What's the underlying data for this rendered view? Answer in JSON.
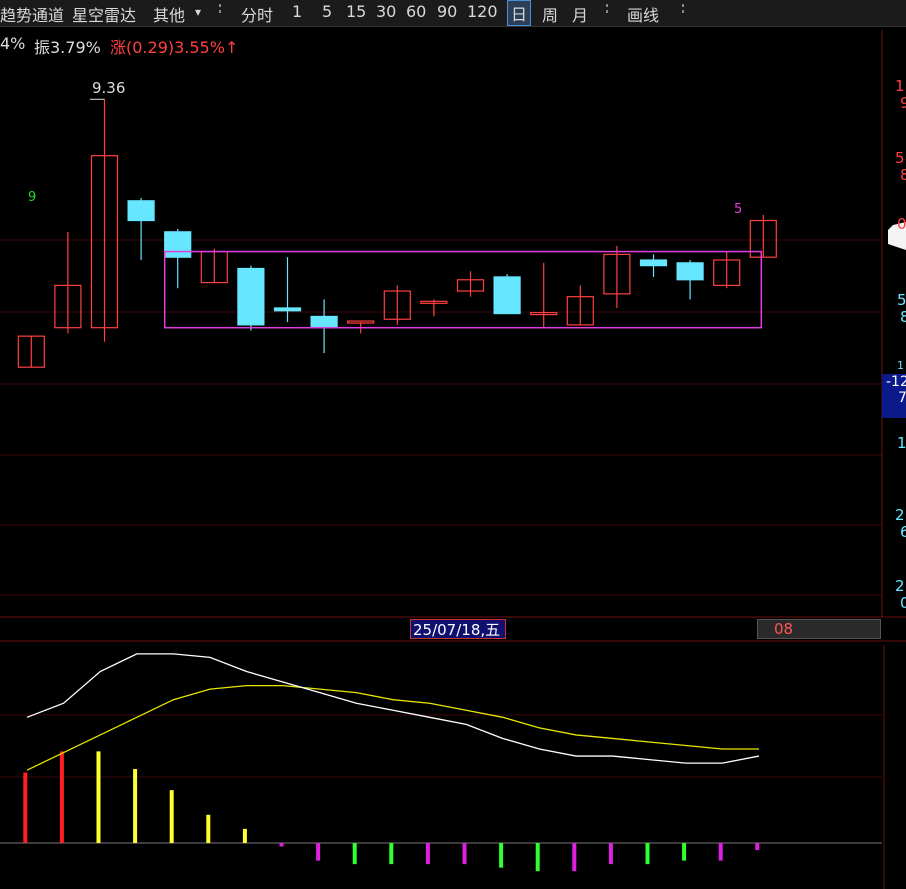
{
  "toolbar": {
    "items": [
      "趋势通道",
      "星空雷达",
      "其他"
    ],
    "dropdown_arrow": "▾",
    "periods": [
      "分时",
      "1",
      "5",
      "15",
      "30",
      "60",
      "90",
      "120",
      "日",
      "周",
      "月"
    ],
    "active_period": "日",
    "draw": "画线"
  },
  "info": {
    "pct": "4%",
    "amplitude": "振3.79%",
    "change": "涨(0.29)3.55%↑"
  },
  "chart_labels": {
    "high": "9.36",
    "count_green": "9",
    "count_magenta": "5"
  },
  "date_cursor": "25/07/18,五",
  "right_value": "08",
  "cursor_values": [
    "-12",
    "7"
  ],
  "right_axis": [
    "1",
    "9",
    "5",
    "8",
    "0",
    "5",
    "8",
    "1",
    "1",
    "2",
    "6",
    "2",
    "0"
  ],
  "colors": {
    "up": "#ff4040",
    "down": "#66e6ff",
    "box": "#e040e0",
    "dif": "#ffffff",
    "dea": "#e6e600"
  },
  "chart_data": [
    {
      "type": "candlestick",
      "series": [
        {
          "open": 8.41,
          "close": 8.52,
          "high": 8.52,
          "low": 8.41
        },
        {
          "open": 8.55,
          "close": 8.7,
          "high": 8.89,
          "low": 8.53
        },
        {
          "open": 8.55,
          "close": 9.16,
          "high": 9.36,
          "low": 8.5
        },
        {
          "open": 9.0,
          "close": 8.93,
          "high": 9.01,
          "low": 8.79
        },
        {
          "open": 8.89,
          "close": 8.8,
          "high": 8.9,
          "low": 8.69
        },
        {
          "open": 8.71,
          "close": 8.82,
          "high": 8.83,
          "low": 8.71
        },
        {
          "open": 8.76,
          "close": 8.56,
          "high": 8.77,
          "low": 8.54
        },
        {
          "open": 8.62,
          "close": 8.61,
          "high": 8.8,
          "low": 8.57
        },
        {
          "open": 8.59,
          "close": 8.55,
          "high": 8.65,
          "low": 8.46
        },
        {
          "open": 8.57,
          "close": 8.57,
          "high": 8.57,
          "low": 8.53
        },
        {
          "open": 8.58,
          "close": 8.68,
          "high": 8.7,
          "low": 8.56
        },
        {
          "open": 8.64,
          "close": 8.64,
          "high": 8.65,
          "low": 8.59
        },
        {
          "open": 8.68,
          "close": 8.72,
          "high": 8.75,
          "low": 8.66
        },
        {
          "open": 8.73,
          "close": 8.6,
          "high": 8.74,
          "low": 8.6
        },
        {
          "open": 8.6,
          "close": 8.6,
          "high": 8.78,
          "low": 8.55
        },
        {
          "open": 8.56,
          "close": 8.66,
          "high": 8.7,
          "low": 8.56
        },
        {
          "open": 8.67,
          "close": 8.81,
          "high": 8.84,
          "low": 8.62
        },
        {
          "open": 8.79,
          "close": 8.77,
          "high": 8.81,
          "low": 8.73
        },
        {
          "open": 8.78,
          "close": 8.72,
          "high": 8.79,
          "low": 8.65
        },
        {
          "open": 8.7,
          "close": 8.79,
          "high": 8.82,
          "low": 8.69
        },
        {
          "open": 8.8,
          "close": 8.93,
          "high": 8.95,
          "low": 8.8
        }
      ],
      "box": {
        "top": 8.82,
        "bottom": 8.55,
        "from_index": 4,
        "to_index": 20
      },
      "ylim": [
        8.4,
        9.4
      ]
    },
    {
      "type": "line",
      "dif": [
        0.3,
        0.34,
        0.43,
        0.48,
        0.48,
        0.47,
        0.43,
        0.4,
        0.37,
        0.34,
        0.32,
        0.3,
        0.28,
        0.24,
        0.21,
        0.19,
        0.19,
        0.18,
        0.17,
        0.17,
        0.19
      ],
      "dea": [
        0.15,
        0.2,
        0.25,
        0.3,
        0.35,
        0.38,
        0.39,
        0.39,
        0.38,
        0.37,
        0.35,
        0.34,
        0.32,
        0.3,
        0.27,
        0.25,
        0.24,
        0.23,
        0.22,
        0.21,
        0.21
      ],
      "macd": [
        0.2,
        0.26,
        0.26,
        0.21,
        0.15,
        0.08,
        0.04,
        -0.01,
        -0.05,
        -0.06,
        -0.06,
        -0.06,
        -0.06,
        -0.07,
        -0.08,
        -0.08,
        -0.06,
        -0.06,
        -0.05,
        -0.05,
        -0.02
      ],
      "ylim": [
        -0.1,
        0.55
      ]
    }
  ]
}
